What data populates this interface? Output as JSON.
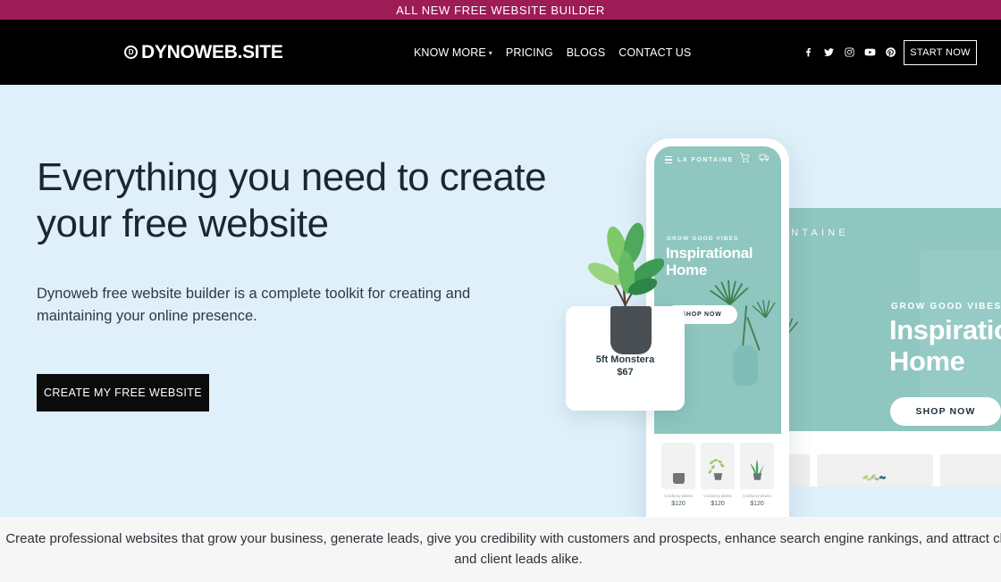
{
  "announcement": {
    "text": "ALL NEW FREE WEBSITE BUILDER",
    "bg": "#9E1C55"
  },
  "navbar": {
    "logo": {
      "mark": "d-circle-icon",
      "text": "DYNOWEB.SITE"
    },
    "links": [
      {
        "label": "KNOW MORE",
        "has_dropdown": true
      },
      {
        "label": "PRICING",
        "has_dropdown": false
      },
      {
        "label": "BLOGS",
        "has_dropdown": false
      },
      {
        "label": "CONTACT US",
        "has_dropdown": false
      }
    ],
    "social": [
      {
        "name": "facebook-icon"
      },
      {
        "name": "twitter-icon"
      },
      {
        "name": "instagram-icon"
      },
      {
        "name": "youtube-icon"
      },
      {
        "name": "pinterest-icon"
      }
    ],
    "cta": "START NOW",
    "bg": "#000000"
  },
  "hero": {
    "heading": "Everything you need to create your free website",
    "subheading": "Dynoweb free website builder is a complete toolkit for creating and maintaining your online presence.",
    "cta": "CREATE MY FREE WEBSITE",
    "bg": "#DFF0FA",
    "artwork": {
      "accent": "#8FC6C0",
      "desktop": {
        "brand": "LA FONTAINE",
        "eyebrow": "GROW GOOD VIBES",
        "title_line1": "Inspirational",
        "title_line2": "Home",
        "shop_button": "SHOP NOW"
      },
      "phone": {
        "brand": "LA FONTAINE",
        "eyebrow": "GROW GOOD VIBES",
        "title_line1": "Inspirational",
        "title_line2": "Home",
        "shop_button": "SHOP NOW",
        "products": [
          {
            "caption": "Corduroy plants",
            "price": "$120"
          },
          {
            "caption": "Corduroy plants",
            "price": "$120"
          },
          {
            "caption": "Corduroy plants",
            "price": "$120"
          }
        ]
      },
      "product_card": {
        "name": "5ft Monstera",
        "price": "$67"
      }
    }
  },
  "bottom": {
    "text": "Create professional websites that grow your business, generate leads, give you credibility with customers and prospects, enhance search engine rankings, and attract clients and client leads alike.",
    "bg": "#F6F6F6"
  }
}
